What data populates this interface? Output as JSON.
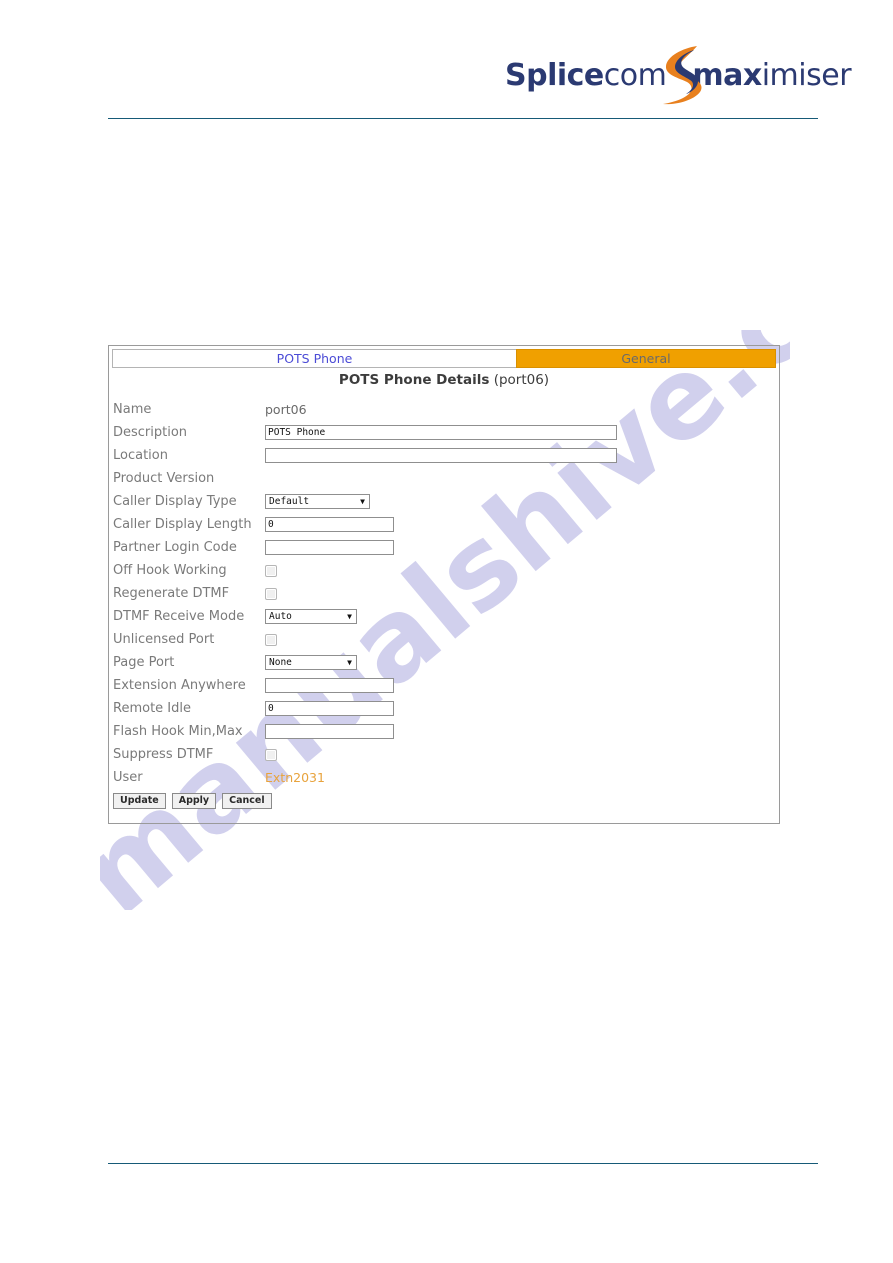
{
  "brand": {
    "logo_part1_bold": "Splice",
    "logo_part1_regular": "com",
    "logo_part2_bold": "max",
    "logo_part2_regular": "imiser",
    "swoosh_orange": "#e8801e",
    "swoosh_blue": "#2b3a72",
    "text_color": "#2b3a72"
  },
  "rules": {
    "color": "#165a77"
  },
  "watermark": {
    "text": "manualshive.com",
    "color": "#c9c8ea"
  },
  "panel": {
    "tabs": [
      {
        "label": "POTS Phone",
        "active": false,
        "style": "white"
      },
      {
        "label": "General",
        "active": true,
        "style": "orange"
      }
    ],
    "heading_main": "POTS Phone Details",
    "heading_sub": "(port06)",
    "accent_orange": "#f0a000",
    "link_color": "#e8a33d",
    "rows": [
      {
        "label": "Name",
        "type": "static",
        "value": "port06"
      },
      {
        "label": "Description",
        "type": "text",
        "value": "POTS Phone",
        "placeholder": ""
      },
      {
        "label": "Location",
        "type": "text",
        "value": "",
        "placeholder": ""
      },
      {
        "label": "Product Version",
        "type": "static",
        "value": ""
      },
      {
        "label": "Caller Display Type",
        "type": "select",
        "value": "Default"
      },
      {
        "label": "Caller Display Length",
        "type": "text",
        "value": "0",
        "placeholder": ""
      },
      {
        "label": "Partner Login Code",
        "type": "text",
        "value": "",
        "placeholder": ""
      },
      {
        "label": "Off Hook Working",
        "type": "checkbox",
        "checked": false
      },
      {
        "label": "Regenerate DTMF",
        "type": "checkbox",
        "checked": false
      },
      {
        "label": "DTMF Receive Mode",
        "type": "select",
        "value": "Auto"
      },
      {
        "label": "Unlicensed Port",
        "type": "checkbox",
        "checked": false
      },
      {
        "label": "Page Port",
        "type": "select",
        "value": "None"
      },
      {
        "label": "Extension Anywhere",
        "type": "text",
        "value": "",
        "placeholder": ""
      },
      {
        "label": "Remote Idle",
        "type": "text",
        "value": "0",
        "placeholder": ""
      },
      {
        "label": "Flash Hook Min,Max",
        "type": "text",
        "value": "",
        "placeholder": ""
      },
      {
        "label": "Suppress DTMF",
        "type": "checkbox",
        "checked": false
      },
      {
        "label": "User",
        "type": "link",
        "value": "Extn2031"
      }
    ],
    "buttons": [
      {
        "label": "Update"
      },
      {
        "label": "Apply"
      },
      {
        "label": "Cancel"
      }
    ]
  }
}
